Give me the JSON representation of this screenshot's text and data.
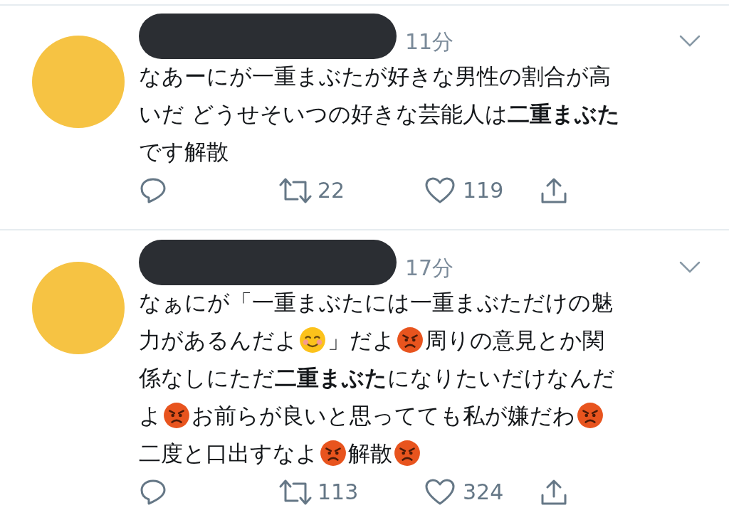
{
  "tweets": [
    {
      "time": "11分",
      "lines": [
        [
          {
            "kind": "text",
            "text": "なあーにが一重まぶたが好きな男性の割合が高"
          }
        ],
        [
          {
            "kind": "text",
            "text": "いだ どうせそいつの好きな芸能人は**二重まぶた**"
          }
        ],
        [
          {
            "kind": "text",
            "text": "です解散"
          }
        ]
      ],
      "retweets": "22",
      "likes": "119"
    },
    {
      "time": "17分",
      "lines": [
        [
          {
            "kind": "text",
            "text": "なぁにが「一重まぶたには一重まぶただけの魅"
          }
        ],
        [
          {
            "kind": "text",
            "text": "力があるんだよ"
          },
          {
            "kind": "smile"
          },
          {
            "kind": "text",
            "text": "」だよ"
          },
          {
            "kind": "angry"
          },
          {
            "kind": "text",
            "text": "周りの意見とか関"
          }
        ],
        [
          {
            "kind": "text",
            "text": "係なしにただ**二重まぶた**になりたいだけなんだ"
          }
        ],
        [
          {
            "kind": "text",
            "text": "よ"
          },
          {
            "kind": "angry"
          },
          {
            "kind": "text",
            "text": "お前らが良いと思ってても私が嫌だわ"
          },
          {
            "kind": "angry"
          }
        ],
        [
          {
            "kind": "text",
            "text": "二度と口出すなよ"
          },
          {
            "kind": "angry"
          },
          {
            "kind": "text",
            "text": "解散"
          },
          {
            "kind": "angry"
          }
        ]
      ],
      "retweets": "113",
      "likes": "324"
    }
  ]
}
